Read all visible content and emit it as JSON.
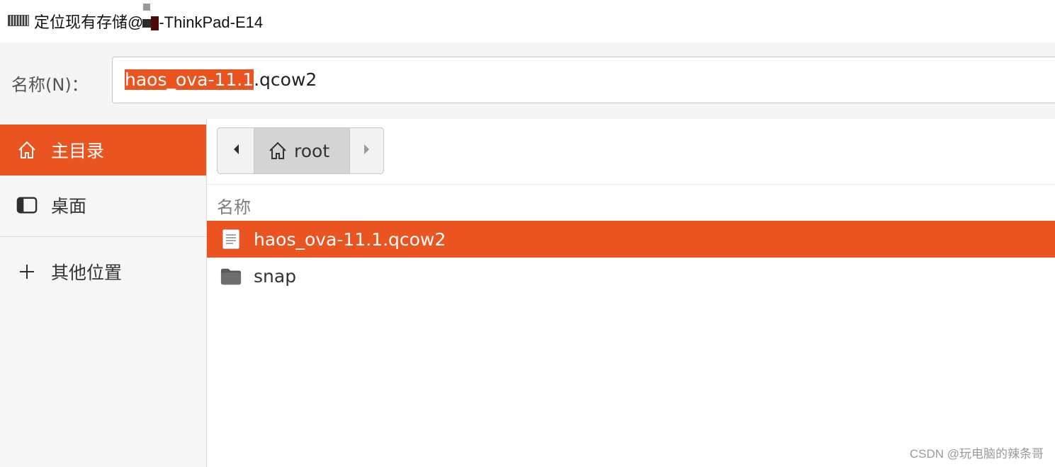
{
  "window": {
    "title_prefix": "定位现有存储@",
    "title_suffix": "-ThinkPad-E14"
  },
  "name_field": {
    "label": "名称(N)：",
    "value_selected": "haos_ova-11.1",
    "value_rest": ".qcow2"
  },
  "sidebar": {
    "items": [
      {
        "label": "主目录",
        "icon": "home-icon",
        "active": true
      },
      {
        "label": "桌面",
        "icon": "desktop-icon",
        "active": false
      },
      {
        "label": "其他位置",
        "icon": "plus-icon",
        "active": false
      }
    ]
  },
  "pathbar": {
    "current": "root"
  },
  "file_list": {
    "column_header": "名称",
    "files": [
      {
        "name": "haos_ova-11.1.qcow2",
        "icon": "file-icon",
        "selected": true
      },
      {
        "name": "snap",
        "icon": "folder-icon",
        "selected": false
      }
    ]
  },
  "watermark": "CSDN @玩电脑的辣条哥",
  "colors": {
    "accent": "#e95420",
    "sidebar_bg": "#f6f6f6"
  }
}
